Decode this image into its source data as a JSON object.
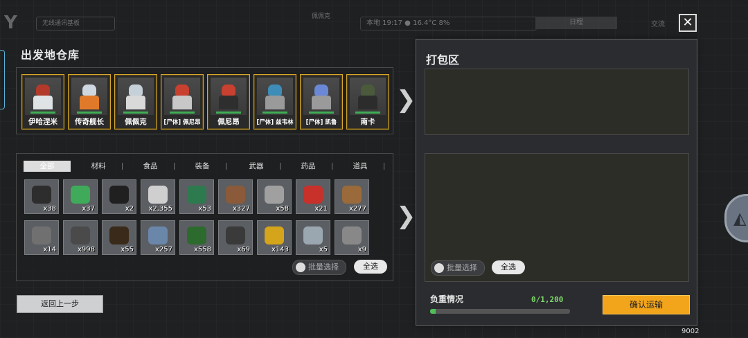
{
  "topbar": {
    "logo": "Y",
    "region_select": "无线通讯基板",
    "center_label": "佩佩克",
    "status": "本地 19:17 ● 16.4°C  8%",
    "status_button": "日程",
    "right_text": "交流"
  },
  "left": {
    "title": "出发地仓库",
    "characters": [
      {
        "name": "伊哈涅米",
        "hair": "#b33a2a",
        "shirt": "#dfe3e6"
      },
      {
        "name": "传奇舰长",
        "hair": "#cfd7e0",
        "shirt": "#e07a2a"
      },
      {
        "name": "佩佩克",
        "hair": "#c6d0d8",
        "shirt": "#d9d9d9"
      },
      {
        "name": "[尸体] 佩尼昂",
        "hair": "#c8402f",
        "shirt": "#c8c8c8"
      },
      {
        "name": "佩尼昂",
        "hair": "#c8402f",
        "shirt": "#2e2e2e"
      },
      {
        "name": "[尸体] 兹韦林",
        "hair": "#3d8db8",
        "shirt": "#9a9a9a"
      },
      {
        "name": "[尸体] 凯鲁",
        "hair": "#6b88d6",
        "shirt": "#9a9a9a"
      },
      {
        "name": "南卡",
        "hair": "#4a5a3a",
        "shirt": "#2c2c2c"
      }
    ],
    "tabs": [
      "全部",
      "材料",
      "食品",
      "装备",
      "武器",
      "药品",
      "道具"
    ],
    "items_row1": [
      {
        "count": "x38",
        "color": "#2d2d2d"
      },
      {
        "count": "x37",
        "color": "#3faa5a"
      },
      {
        "count": "x2",
        "color": "#202020"
      },
      {
        "count": "x2,355",
        "color": "#cfcfcf"
      },
      {
        "count": "x53",
        "color": "#2d7a4e"
      },
      {
        "count": "x327",
        "color": "#8a5a3a"
      },
      {
        "count": "x58",
        "color": "#a0a0a0"
      },
      {
        "count": "x21",
        "color": "#c8302a"
      },
      {
        "count": "x277",
        "color": "#9a6a3a"
      }
    ],
    "items_row2": [
      {
        "count": "x14",
        "color": "#707070"
      },
      {
        "count": "x998",
        "color": "#4a4a4a"
      },
      {
        "count": "x55",
        "color": "#3a2a1a"
      },
      {
        "count": "x257",
        "color": "#6a86a8"
      },
      {
        "count": "x558",
        "color": "#2d6a2d"
      },
      {
        "count": "x69",
        "color": "#3a3a3a"
      },
      {
        "count": "x143",
        "color": "#d4a41a"
      },
      {
        "count": "x5",
        "color": "#9aa6b0"
      },
      {
        "count": "x9",
        "color": "#888888"
      }
    ],
    "batch_select": "批量选择",
    "select_all": "全选",
    "back": "返回上一步"
  },
  "right": {
    "title": "打包区",
    "batch_select": "批量选择",
    "select_all": "全选",
    "load_label": "负重情况",
    "load_value": "0/1,200",
    "load_fraction": 0.04,
    "confirm": "确认运输"
  },
  "close_label": "✕",
  "bottom_number": "9002",
  "arrow_glyph": "❯"
}
